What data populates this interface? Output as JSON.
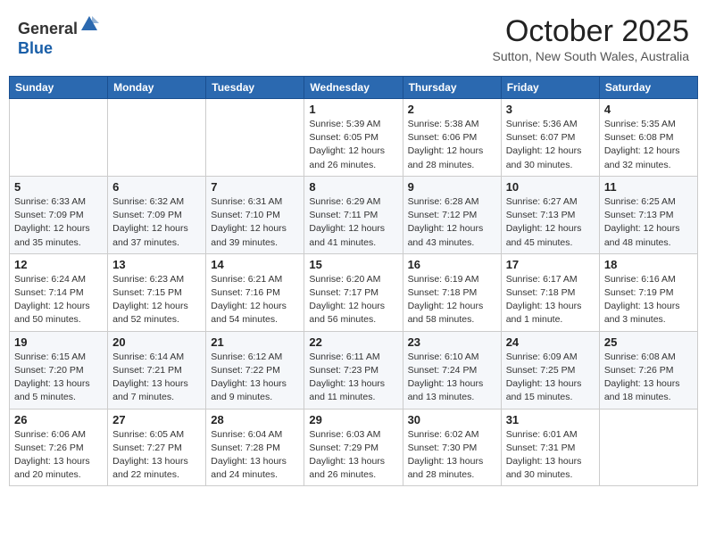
{
  "logo": {
    "general": "General",
    "blue": "Blue"
  },
  "title": "October 2025",
  "location": "Sutton, New South Wales, Australia",
  "days_of_week": [
    "Sunday",
    "Monday",
    "Tuesday",
    "Wednesday",
    "Thursday",
    "Friday",
    "Saturday"
  ],
  "weeks": [
    [
      {
        "day": "",
        "info": ""
      },
      {
        "day": "",
        "info": ""
      },
      {
        "day": "",
        "info": ""
      },
      {
        "day": "1",
        "info": "Sunrise: 5:39 AM\nSunset: 6:05 PM\nDaylight: 12 hours\nand 26 minutes."
      },
      {
        "day": "2",
        "info": "Sunrise: 5:38 AM\nSunset: 6:06 PM\nDaylight: 12 hours\nand 28 minutes."
      },
      {
        "day": "3",
        "info": "Sunrise: 5:36 AM\nSunset: 6:07 PM\nDaylight: 12 hours\nand 30 minutes."
      },
      {
        "day": "4",
        "info": "Sunrise: 5:35 AM\nSunset: 6:08 PM\nDaylight: 12 hours\nand 32 minutes."
      }
    ],
    [
      {
        "day": "5",
        "info": "Sunrise: 6:33 AM\nSunset: 7:09 PM\nDaylight: 12 hours\nand 35 minutes."
      },
      {
        "day": "6",
        "info": "Sunrise: 6:32 AM\nSunset: 7:09 PM\nDaylight: 12 hours\nand 37 minutes."
      },
      {
        "day": "7",
        "info": "Sunrise: 6:31 AM\nSunset: 7:10 PM\nDaylight: 12 hours\nand 39 minutes."
      },
      {
        "day": "8",
        "info": "Sunrise: 6:29 AM\nSunset: 7:11 PM\nDaylight: 12 hours\nand 41 minutes."
      },
      {
        "day": "9",
        "info": "Sunrise: 6:28 AM\nSunset: 7:12 PM\nDaylight: 12 hours\nand 43 minutes."
      },
      {
        "day": "10",
        "info": "Sunrise: 6:27 AM\nSunset: 7:13 PM\nDaylight: 12 hours\nand 45 minutes."
      },
      {
        "day": "11",
        "info": "Sunrise: 6:25 AM\nSunset: 7:13 PM\nDaylight: 12 hours\nand 48 minutes."
      }
    ],
    [
      {
        "day": "12",
        "info": "Sunrise: 6:24 AM\nSunset: 7:14 PM\nDaylight: 12 hours\nand 50 minutes."
      },
      {
        "day": "13",
        "info": "Sunrise: 6:23 AM\nSunset: 7:15 PM\nDaylight: 12 hours\nand 52 minutes."
      },
      {
        "day": "14",
        "info": "Sunrise: 6:21 AM\nSunset: 7:16 PM\nDaylight: 12 hours\nand 54 minutes."
      },
      {
        "day": "15",
        "info": "Sunrise: 6:20 AM\nSunset: 7:17 PM\nDaylight: 12 hours\nand 56 minutes."
      },
      {
        "day": "16",
        "info": "Sunrise: 6:19 AM\nSunset: 7:18 PM\nDaylight: 12 hours\nand 58 minutes."
      },
      {
        "day": "17",
        "info": "Sunrise: 6:17 AM\nSunset: 7:18 PM\nDaylight: 13 hours\nand 1 minute."
      },
      {
        "day": "18",
        "info": "Sunrise: 6:16 AM\nSunset: 7:19 PM\nDaylight: 13 hours\nand 3 minutes."
      }
    ],
    [
      {
        "day": "19",
        "info": "Sunrise: 6:15 AM\nSunset: 7:20 PM\nDaylight: 13 hours\nand 5 minutes."
      },
      {
        "day": "20",
        "info": "Sunrise: 6:14 AM\nSunset: 7:21 PM\nDaylight: 13 hours\nand 7 minutes."
      },
      {
        "day": "21",
        "info": "Sunrise: 6:12 AM\nSunset: 7:22 PM\nDaylight: 13 hours\nand 9 minutes."
      },
      {
        "day": "22",
        "info": "Sunrise: 6:11 AM\nSunset: 7:23 PM\nDaylight: 13 hours\nand 11 minutes."
      },
      {
        "day": "23",
        "info": "Sunrise: 6:10 AM\nSunset: 7:24 PM\nDaylight: 13 hours\nand 13 minutes."
      },
      {
        "day": "24",
        "info": "Sunrise: 6:09 AM\nSunset: 7:25 PM\nDaylight: 13 hours\nand 15 minutes."
      },
      {
        "day": "25",
        "info": "Sunrise: 6:08 AM\nSunset: 7:26 PM\nDaylight: 13 hours\nand 18 minutes."
      }
    ],
    [
      {
        "day": "26",
        "info": "Sunrise: 6:06 AM\nSunset: 7:26 PM\nDaylight: 13 hours\nand 20 minutes."
      },
      {
        "day": "27",
        "info": "Sunrise: 6:05 AM\nSunset: 7:27 PM\nDaylight: 13 hours\nand 22 minutes."
      },
      {
        "day": "28",
        "info": "Sunrise: 6:04 AM\nSunset: 7:28 PM\nDaylight: 13 hours\nand 24 minutes."
      },
      {
        "day": "29",
        "info": "Sunrise: 6:03 AM\nSunset: 7:29 PM\nDaylight: 13 hours\nand 26 minutes."
      },
      {
        "day": "30",
        "info": "Sunrise: 6:02 AM\nSunset: 7:30 PM\nDaylight: 13 hours\nand 28 minutes."
      },
      {
        "day": "31",
        "info": "Sunrise: 6:01 AM\nSunset: 7:31 PM\nDaylight: 13 hours\nand 30 minutes."
      },
      {
        "day": "",
        "info": ""
      }
    ]
  ]
}
